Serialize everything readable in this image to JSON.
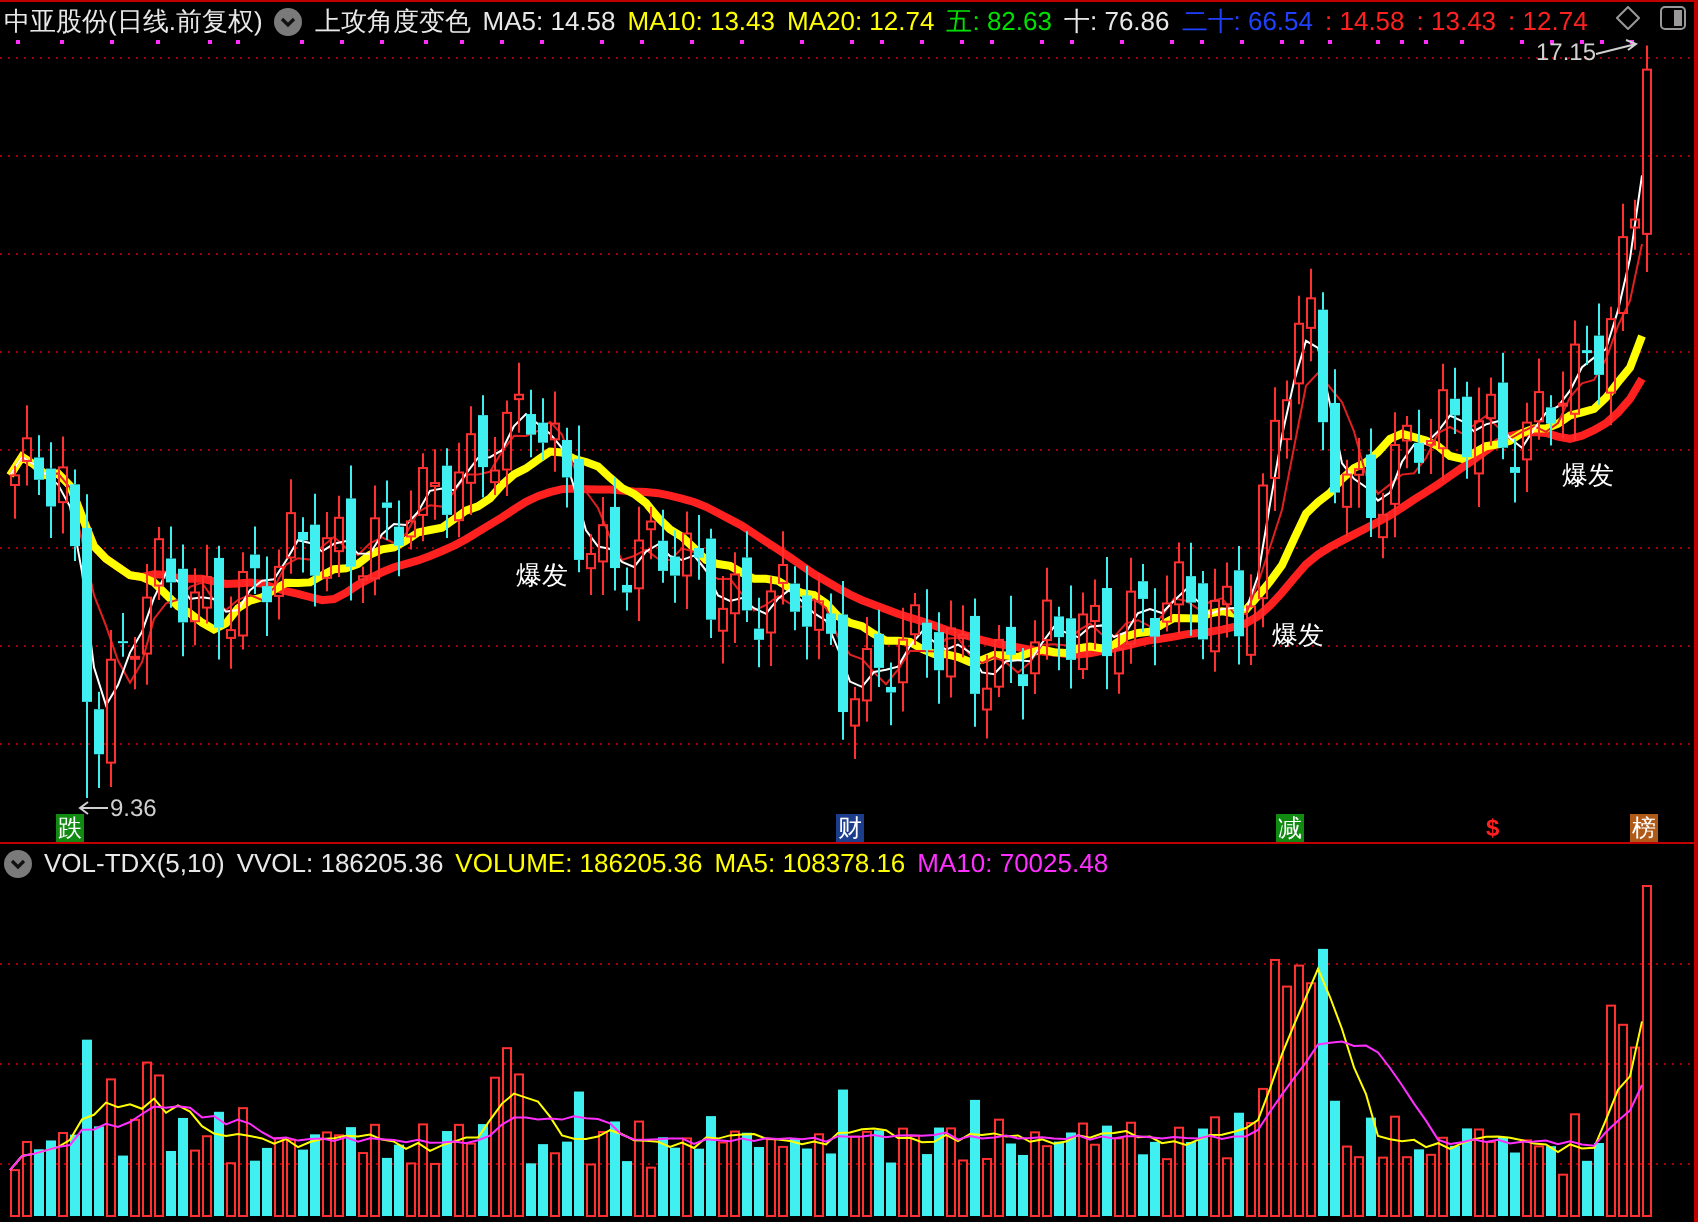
{
  "price_panel": {
    "title": "中亚股份(日线.前复权)",
    "indicator": "上攻角度变色",
    "legend": [
      {
        "text": "MA5: 14.58",
        "color": "#e8e8e8"
      },
      {
        "text": "MA10: 13.43",
        "color": "#ffff00"
      },
      {
        "text": "MA20: 12.74",
        "color": "#ffff00"
      },
      {
        "text": "五: 82.63",
        "color": "#00e000"
      },
      {
        "text": "十: 76.86",
        "color": "#e8e8e8"
      },
      {
        "text": "二十: 66.54",
        "color": "#2040ff"
      },
      {
        "text": ": 14.58",
        "color": "#ff2020"
      },
      {
        "text": ": 13.43",
        "color": "#ff2020"
      },
      {
        "text": ": 12.74",
        "color": "#ff2020"
      }
    ],
    "high_label": "17.15",
    "low_label": "9.36",
    "signals": [
      {
        "text": "爆发"
      },
      {
        "text": "爆发"
      },
      {
        "text": "爆发"
      }
    ],
    "events": [
      {
        "text": "跌",
        "kind": "badge",
        "color": "#108a10"
      },
      {
        "text": "财",
        "kind": "badge",
        "color": "#1c3c8c"
      },
      {
        "text": "减",
        "kind": "badge",
        "color": "#108a10"
      },
      {
        "text": "$",
        "kind": "glyph",
        "color": "#ff2020"
      },
      {
        "text": "榜",
        "kind": "badge",
        "color": "#b05a18"
      }
    ]
  },
  "volume_panel": {
    "title": "VOL-TDX(5,10)",
    "legend": [
      {
        "text": "VVOL: 186205.36",
        "color": "#e8e8e8"
      },
      {
        "text": "VOLUME: 186205.36",
        "color": "#ffff00"
      },
      {
        "text": "MA5: 108378.16",
        "color": "#ffff00"
      },
      {
        "text": "MA10: 70025.48",
        "color": "#ff30ff"
      }
    ]
  }
}
